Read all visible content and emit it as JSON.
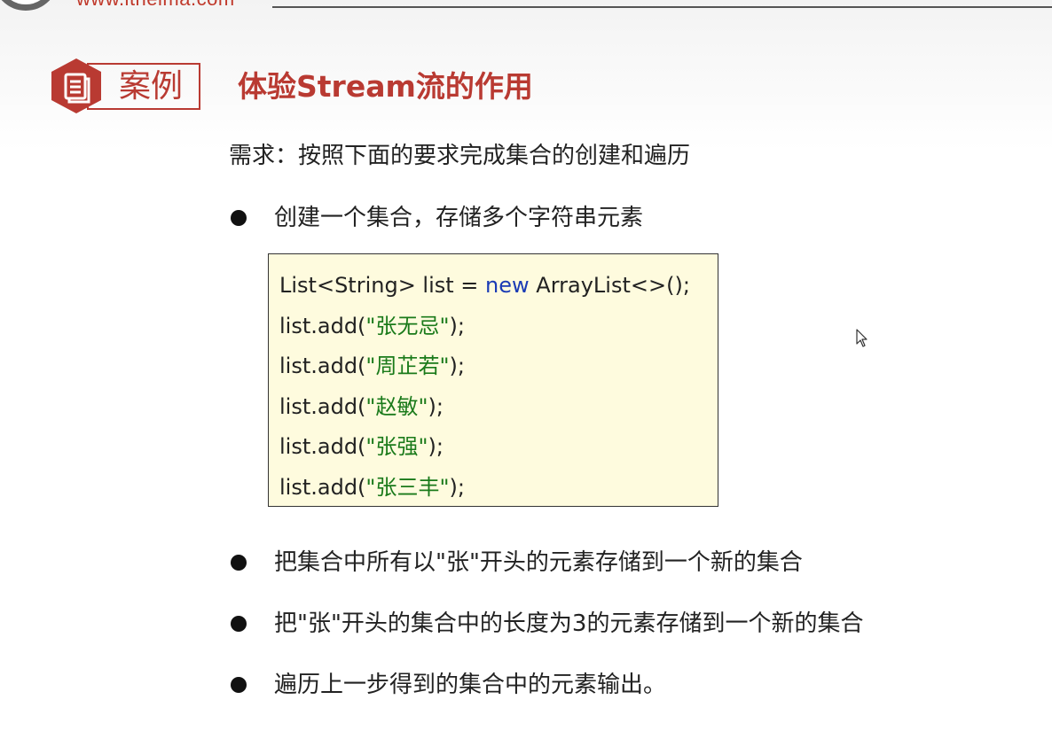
{
  "header": {
    "site_url": "www.itheima.com"
  },
  "case": {
    "label": "案例",
    "title": "体验Stream流的作用",
    "icon": "document-icon"
  },
  "content": {
    "requirement": "需求：按照下面的要求完成集合的创建和遍历",
    "bullets": [
      "创建一个集合，存储多个字符串元素",
      "把集合中所有以\"张\"开头的元素存储到一个新的集合",
      "把\"张\"开头的集合中的长度为3的元素存储到一个新的集合",
      "遍历上一步得到的集合中的元素输出。"
    ]
  },
  "code": {
    "line1": {
      "prefix": "List<String> list = ",
      "keyword": "new",
      "suffix": " ArrayList<>();"
    },
    "add_prefix": "list.add(",
    "add_suffix": ");",
    "adds": [
      "\"张无忌\"",
      "\"周芷若\"",
      "\"赵敏\"",
      "\"张强\"",
      "\"张三丰\""
    ]
  },
  "colors": {
    "accent": "#b93a32",
    "code_background": "#fefbde",
    "keyword": "#1a3bb5",
    "string": "#1a7a1a"
  }
}
